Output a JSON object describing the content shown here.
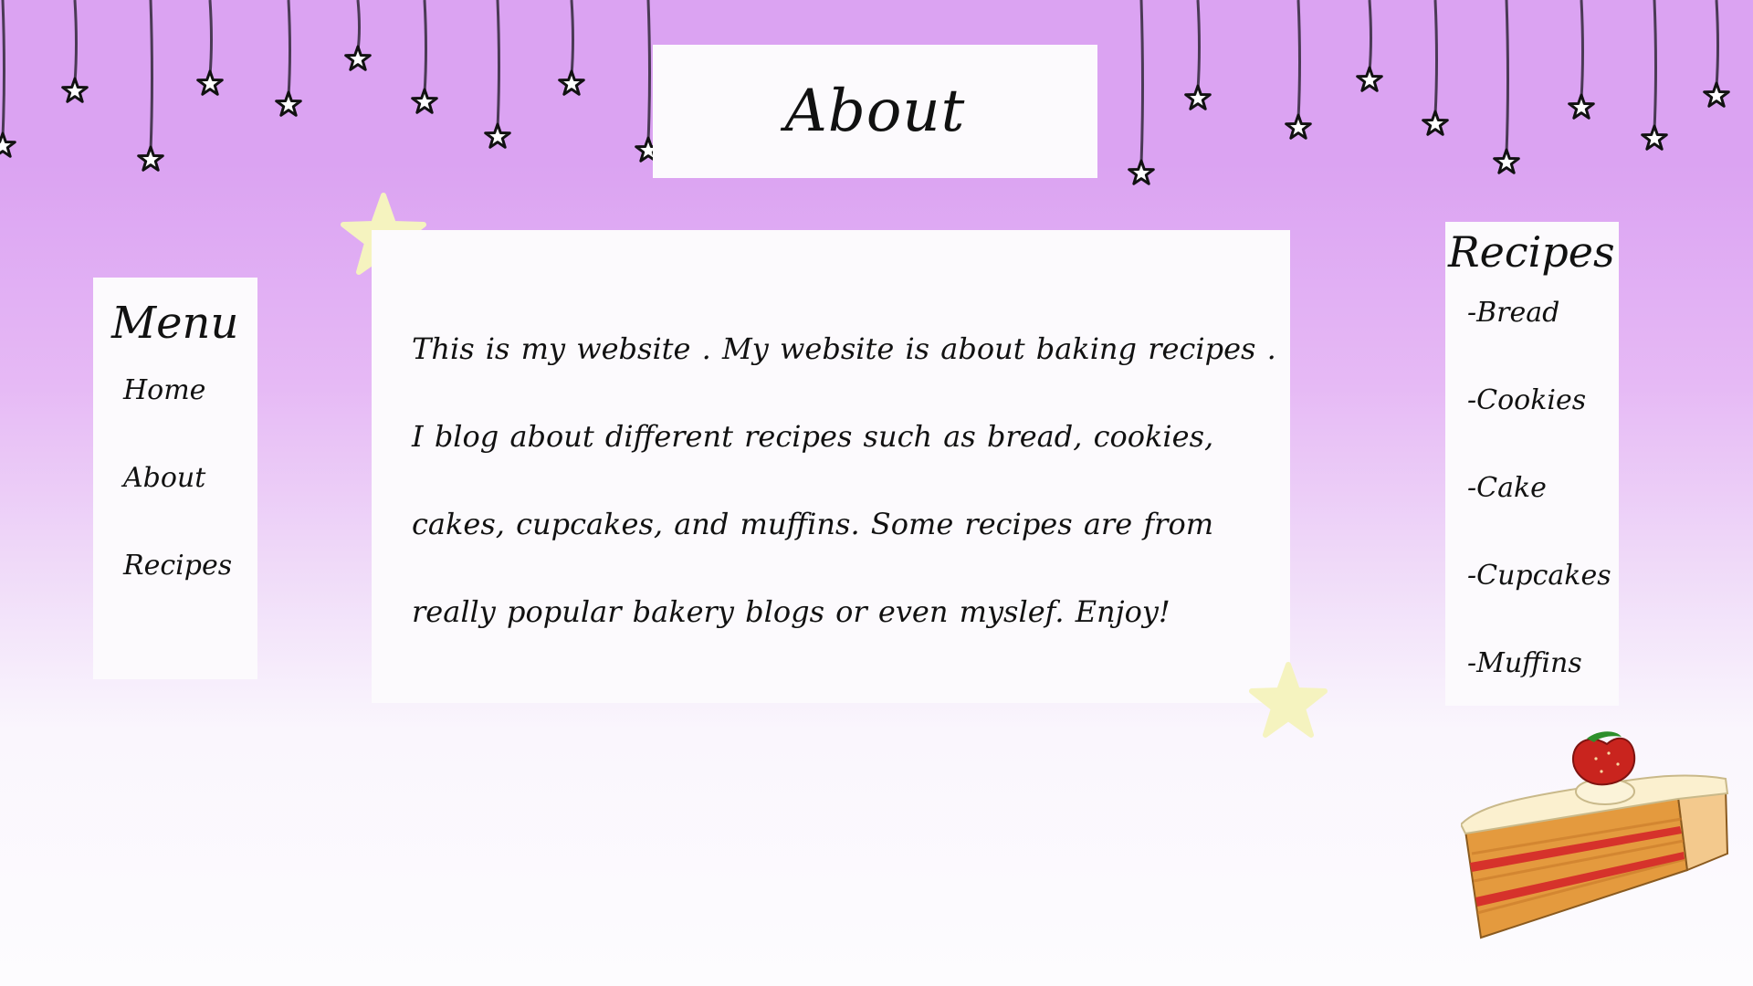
{
  "header": {
    "title": "About"
  },
  "menu": {
    "heading": "Menu",
    "items": [
      {
        "label": "Home"
      },
      {
        "label": "About"
      },
      {
        "label": "Recipes"
      }
    ]
  },
  "content": {
    "paragraph": "This is my website . My website is about baking  recipes . I blog about different recipes such as bread, cookies, cakes, cupcakes, and muffins. Some recipes are from really popular bakery blogs or even myslef.  Enjoy!"
  },
  "recipes": {
    "heading": "Recipes",
    "items": [
      {
        "label": "-Bread"
      },
      {
        "label": "-Cookies"
      },
      {
        "label": "-Cake"
      },
      {
        "label": "-Cupcakes"
      },
      {
        "label": "-Muffins"
      }
    ]
  },
  "colors": {
    "background_top": "#dba3f2",
    "background_bottom": "#fdfcfe",
    "panel": "#fcfafd",
    "star_accent": "#f5f3bf",
    "text": "#111111"
  },
  "icons": {
    "hanging_decoration": "hanging-star-icon",
    "accent_star": "star-icon",
    "corner_image": "cake-slice-icon"
  }
}
